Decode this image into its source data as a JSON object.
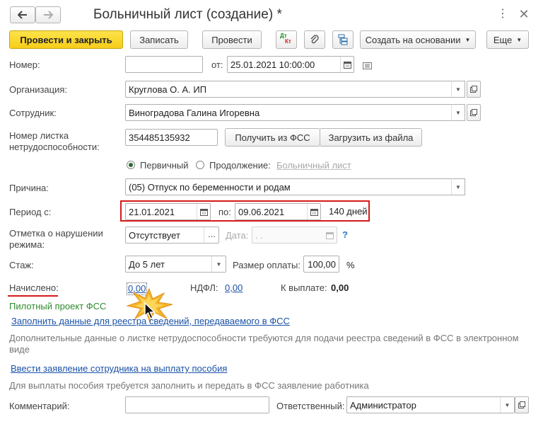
{
  "window": {
    "title": "Больничный лист (создание) *"
  },
  "toolbar": {
    "post_close": "Провести и закрыть",
    "save": "Записать",
    "post": "Провести",
    "dtkt_top": "Дт",
    "dtkt_bottom": "Кт",
    "create_based": "Создать на основании",
    "more": "Еще"
  },
  "form": {
    "number_label": "Номер:",
    "number_value": "",
    "from_label": "от:",
    "date_value": "25.01.2021 10:00:00",
    "org_label": "Организация:",
    "org_value": "Круглова О. А. ИП",
    "employee_label": "Сотрудник:",
    "employee_value": "Виноградова Галина Игоревна",
    "sheet_label_1": "Номер листка",
    "sheet_label_2": "нетрудоспособности:",
    "sheet_value": "354485135932",
    "get_fss": "Получить из ФСС",
    "load_file": "Загрузить из файла",
    "primary": "Первичный",
    "continuation": "Продолжение:",
    "sick_leave_link": "Больничный лист",
    "reason_label": "Причина:",
    "reason_value": "(05) Отпуск по беременности и родам",
    "period_label": "Период с:",
    "period_from": "21.01.2021",
    "period_to_label": "по:",
    "period_to": "09.06.2021",
    "days": "140 дней",
    "violation_label_1": "Отметка о нарушении",
    "violation_label_2": "режима:",
    "violation_value": "Отсутствует",
    "date_label": "Дата:",
    "date_placeholder": " .  .",
    "help": "?",
    "experience_label": "Стаж:",
    "experience_value": "До 5 лет",
    "pay_size_label": "Размер оплаты:",
    "pay_size_value": "100,00",
    "percent": "%",
    "accrued_label": "Начислено:",
    "accrued_value": "0,00",
    "ndfl_label": "НДФЛ:",
    "ndfl_value": "0,00",
    "to_pay_label": "К выплате:",
    "to_pay_value": "0,00",
    "pilot": "Пилотный проект ФСС",
    "fill_registry_link": "Заполнить данные для реестра сведений, передаваемого в ФСС",
    "registry_hint": "Дополнительные данные о листке нетрудоспособности требуются для подачи реестра сведений в ФСС в электронном виде",
    "enter_application_link": "Ввести заявление сотрудника на выплату пособия",
    "application_hint": "Для выплаты пособия требуется заполнить и передать в ФСС заявление работника",
    "comment_label": "Комментарий:",
    "comment_value": "",
    "responsible_label": "Ответственный:",
    "responsible_value": "Администратор"
  },
  "colors": {
    "highlight_red": "#d61a1a",
    "primary_yellow": "#f6cd1a",
    "link_blue": "#1a52a8",
    "pilot_green": "#2e8b2e",
    "star_orange": "#f3a21b"
  }
}
